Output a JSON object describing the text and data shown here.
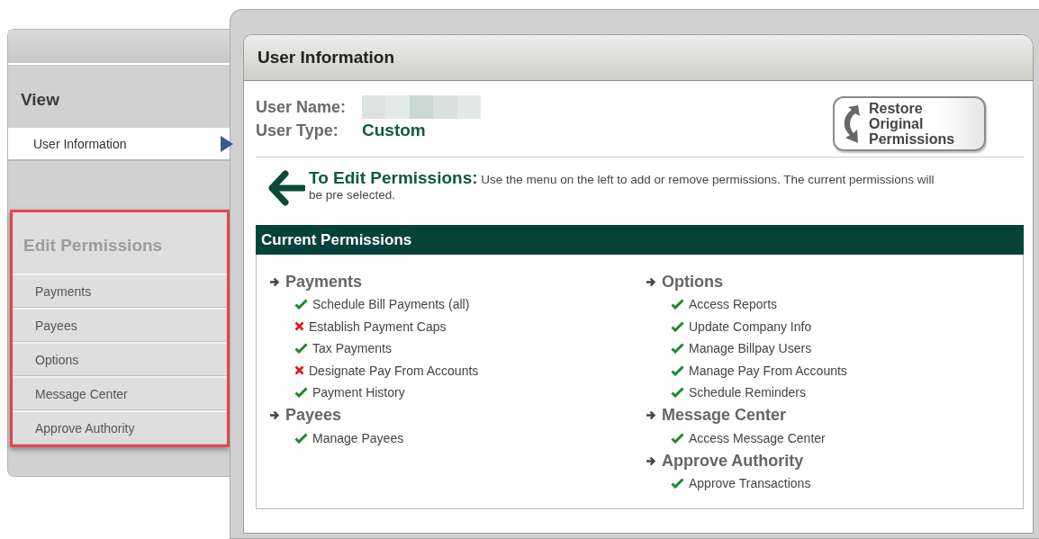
{
  "sidebar": {
    "sections": [
      {
        "title": "View",
        "highlighted": false,
        "items": [
          {
            "label": "User Information",
            "selected": true
          }
        ]
      },
      {
        "title": "Edit Permissions",
        "highlighted": true,
        "items": [
          {
            "label": "Payments",
            "selected": false
          },
          {
            "label": "Payees",
            "selected": false
          },
          {
            "label": "Options",
            "selected": false
          },
          {
            "label": "Message Center",
            "selected": false
          },
          {
            "label": "Approve Authority",
            "selected": false
          }
        ]
      }
    ]
  },
  "panel": {
    "title": "User Information",
    "fields": [
      {
        "label": "User Name:",
        "kind": "redacted"
      },
      {
        "label": "User Type:",
        "kind": "text",
        "value": "Custom"
      }
    ],
    "restore_button": "Restore Original Permissions",
    "hint": {
      "title": "To Edit Permissions:",
      "text": "Use the menu on the left to add or remove permissions. The current permissions will be pre selected."
    },
    "permissions": {
      "title": "Current Permissions",
      "columns": [
        [
          {
            "name": "Payments",
            "items": [
              {
                "label": "Schedule Bill Payments (all)",
                "granted": true
              },
              {
                "label": "Establish Payment Caps",
                "granted": false
              },
              {
                "label": "Tax Payments",
                "granted": true
              },
              {
                "label": "Designate Pay From Accounts",
                "granted": false
              },
              {
                "label": "Payment History",
                "granted": true
              }
            ]
          },
          {
            "name": "Payees",
            "items": [
              {
                "label": "Manage Payees",
                "granted": true
              }
            ]
          }
        ],
        [
          {
            "name": "Options",
            "items": [
              {
                "label": "Access Reports",
                "granted": true
              },
              {
                "label": "Update Company Info",
                "granted": true
              },
              {
                "label": "Manage Billpay Users",
                "granted": true
              },
              {
                "label": "Manage Pay From Accounts",
                "granted": true
              },
              {
                "label": "Schedule Reminders",
                "granted": true
              }
            ]
          },
          {
            "name": "Message Center",
            "items": [
              {
                "label": "Access Message Center",
                "granted": true
              }
            ]
          },
          {
            "name": "Approve Authority",
            "items": [
              {
                "label": "Approve Transactions",
                "granted": true
              }
            ]
          }
        ]
      ]
    }
  }
}
